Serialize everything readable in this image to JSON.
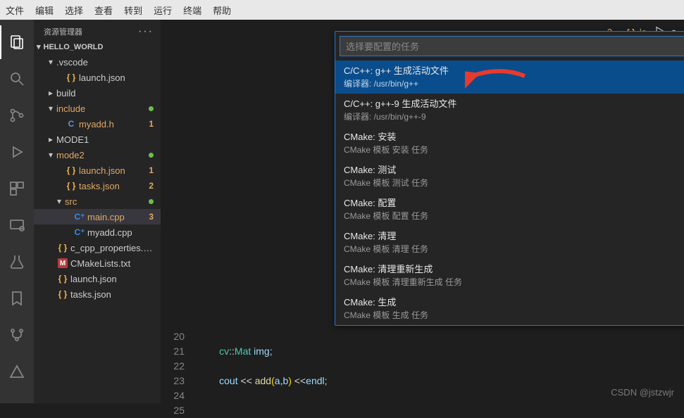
{
  "menubar": [
    "文件",
    "编辑",
    "选择",
    "查看",
    "转到",
    "运行",
    "终端",
    "帮助"
  ],
  "sidebar": {
    "title": "资源管理器",
    "project": "HELLO_WORLD",
    "tree": [
      {
        "indent": 1,
        "chev": "▾",
        "label": ".vscode",
        "orange": false
      },
      {
        "indent": 2,
        "chev": "",
        "icon": "json",
        "label": "launch.json",
        "orange": false
      },
      {
        "indent": 1,
        "chev": "▸",
        "label": "build",
        "orange": false
      },
      {
        "indent": 1,
        "chev": "▾",
        "label": "include",
        "orange": true,
        "badge": "•",
        "dot": true
      },
      {
        "indent": 2,
        "chev": "",
        "icon": "c",
        "label": "myadd.h",
        "orange": true,
        "badge": "1"
      },
      {
        "indent": 1,
        "chev": "▸",
        "label": "MODE1",
        "orange": false
      },
      {
        "indent": 1,
        "chev": "▾",
        "label": "mode2",
        "orange": true,
        "badge": "•",
        "dot": true
      },
      {
        "indent": 2,
        "chev": "",
        "icon": "json",
        "label": "launch.json",
        "orange": true,
        "badge": "1"
      },
      {
        "indent": 2,
        "chev": "",
        "icon": "json",
        "label": "tasks.json",
        "orange": true,
        "badge": "2"
      },
      {
        "indent": 2,
        "chev": "▾",
        "label": "src",
        "orange": true,
        "dot": true
      },
      {
        "indent": 3,
        "chev": "",
        "icon": "cpp",
        "label": "main.cpp",
        "orange": true,
        "badge": "3",
        "selected": true
      },
      {
        "indent": 3,
        "chev": "",
        "icon": "cpp",
        "label": "myadd.cpp",
        "orange": false
      },
      {
        "indent": 1,
        "chev": "",
        "icon": "json",
        "label": "c_cpp_properties.json",
        "orange": false
      },
      {
        "indent": 1,
        "chev": "",
        "icon": "m",
        "label": "CMakeLists.txt",
        "orange": false
      },
      {
        "indent": 1,
        "chev": "",
        "icon": "json",
        "label": "launch.json",
        "orange": false
      },
      {
        "indent": 1,
        "chev": "",
        "icon": "json",
        "label": "tasks.json",
        "orange": false
      }
    ]
  },
  "quickInput": {
    "placeholder": "选择要配置的任务",
    "items": [
      {
        "t1": "C/C++: g++ 生成活动文件",
        "t2": "编译器: /usr/bin/g++",
        "selected": true
      },
      {
        "t1": "C/C++: g++-9 生成活动文件",
        "t2": "编译器: /usr/bin/g++-9"
      },
      {
        "t1": "CMake: 安装",
        "t2": "CMake 模板 安装 任务"
      },
      {
        "t1": "CMake: 测试",
        "t2": "CMake 模板 测试 任务"
      },
      {
        "t1": "CMake: 配置",
        "t2": "CMake 模板 配置 任务"
      },
      {
        "t1": "CMake: 清理",
        "t2": "CMake 模板 清理 任务"
      },
      {
        "t1": "CMake: 清理重新生成",
        "t2": "CMake 模板 清理重新生成 任务"
      },
      {
        "t1": "CMake: 生成",
        "t2": "CMake 模板 生成 任务"
      }
    ]
  },
  "tabRight": {
    "num": "2",
    "json": "{ }",
    "la": "la"
  },
  "code": {
    "start": 20,
    "lines": [
      {
        "n": 20,
        "html": ""
      },
      {
        "n": 21,
        "html": "        <span class='tok-ns'>cv</span>::<span class='tok-ns'>Mat</span> <span class='tok-var'>img</span>;"
      },
      {
        "n": 22,
        "html": ""
      },
      {
        "n": 23,
        "html": "        <span class='tok-var'>cout</span> &lt;&lt; <span class='tok-fn'>add</span><span class='tok-br'>(</span><span class='tok-var'>a</span>,<span class='tok-var'>b</span><span class='tok-br'>)</span> &lt;&lt;<span class='tok-var'>endl</span>;"
      },
      {
        "n": 24,
        "html": ""
      },
      {
        "n": 25,
        "html": ""
      }
    ]
  },
  "watermark": "CSDN @jstzwjr"
}
